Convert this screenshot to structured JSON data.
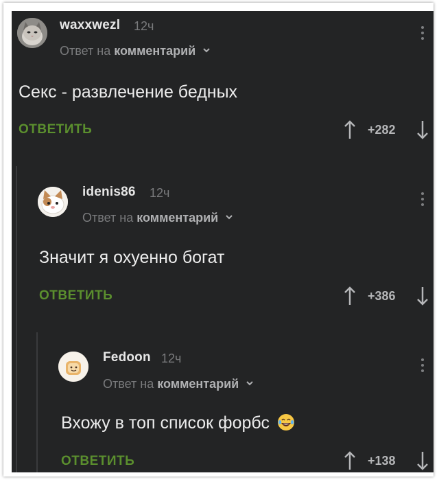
{
  "comments": [
    {
      "username": "waxxwezl",
      "time": "12ч",
      "reply_prefix": "Ответ на",
      "reply_target": "комментарий",
      "text": "Секс - развлечение бедных",
      "reply_label": "ОТВЕТИТЬ",
      "score": "+282",
      "avatar": "cat-avatar"
    },
    {
      "username": "idenis86",
      "time": "12ч",
      "reply_prefix": "Ответ на",
      "reply_target": "комментарий",
      "text": "Значит я охуенно богат",
      "reply_label": "ОТВЕТИТЬ",
      "score": "+386",
      "avatar": "cartoon-cat-avatar"
    },
    {
      "username": "Fedoon",
      "time": "12ч",
      "reply_prefix": "Ответ на",
      "reply_target": "комментарий",
      "text": "Вхожу в топ список форбс",
      "reply_label": "ОТВЕТИТЬ",
      "score": "+138",
      "avatar": "toast-avatar",
      "emoji": "laughing-tears-emoji"
    }
  ],
  "colors": {
    "background": "#232425",
    "reply_green": "#5b8f2e",
    "text": "#ececec",
    "muted": "#7a7b7d"
  }
}
